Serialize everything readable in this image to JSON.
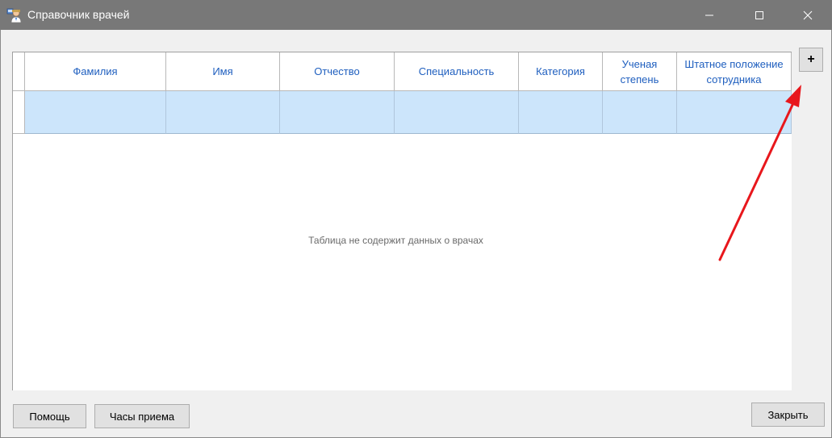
{
  "window": {
    "title": "Справочник врачей",
    "icon": "doctor-icon"
  },
  "grid": {
    "columns": [
      "Фамилия",
      "Имя",
      "Отчество",
      "Специальность",
      "Категория",
      "Ученая степень",
      "Штатное положение сотрудника"
    ],
    "selected_row_color": "#cce5fb",
    "header_text_color": "#1f5fbf",
    "empty_message": "Таблица не содержит данных о врачах"
  },
  "buttons": {
    "add_label": "+",
    "help_label": "Помощь",
    "hours_label": "Часы приема",
    "close_label": "Закрыть"
  },
  "annotation": {
    "arrow_color": "#e8171c"
  }
}
